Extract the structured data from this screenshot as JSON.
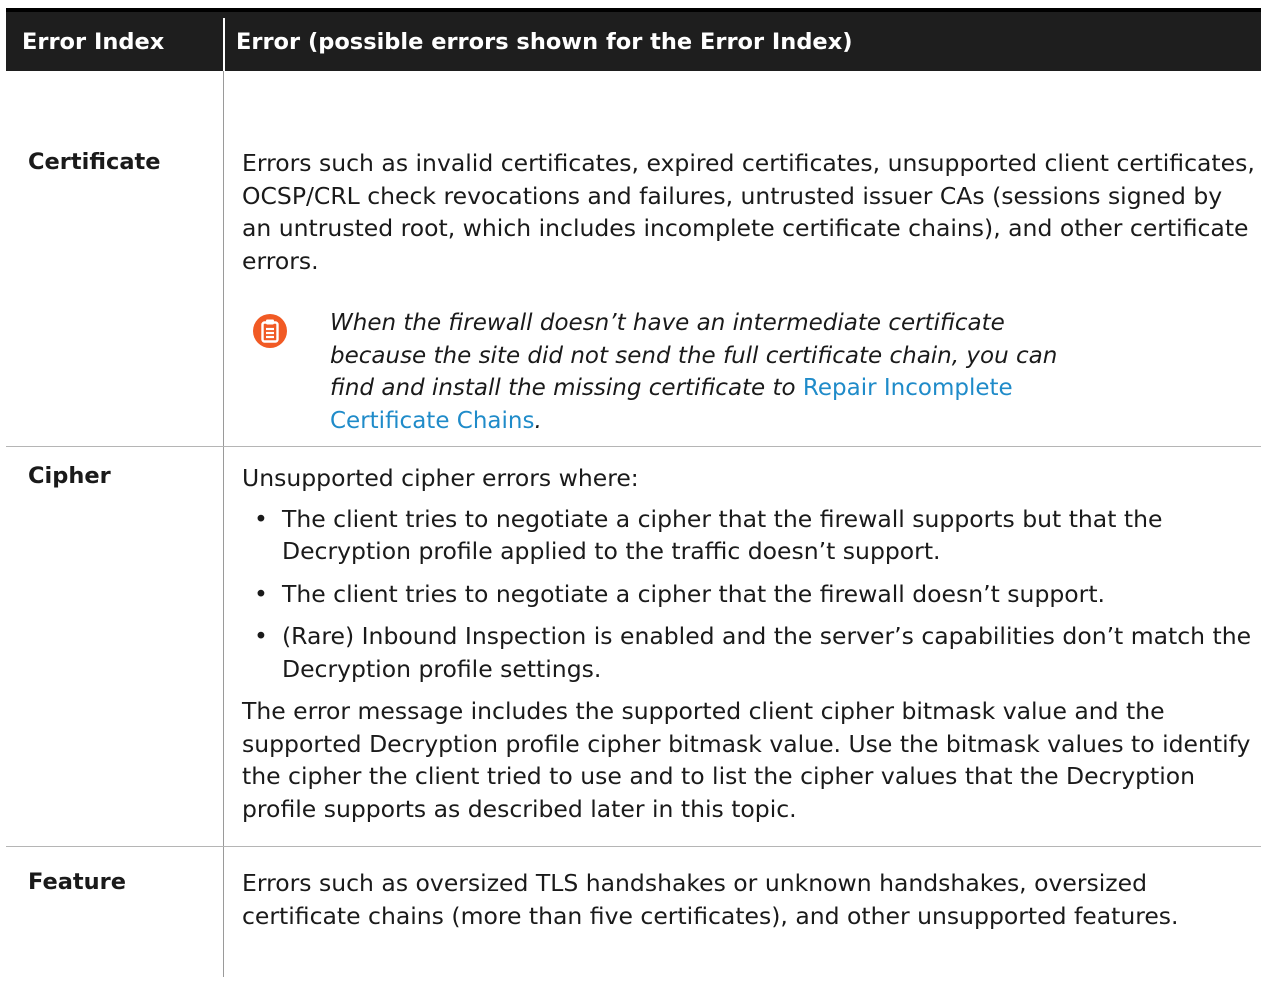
{
  "header": {
    "col1": "Error Index",
    "col2": "Error (possible errors shown for the Error Index)"
  },
  "rows": {
    "certificate": {
      "label": "Certificate",
      "text": "Errors such as invalid certificates, expired certificates, unsupported client certificates, OCSP/CRL check revocations and failures, untrusted issuer CAs (sessions signed by an untrusted root, which includes incomplete certificate chains), and other certificate errors.",
      "note": {
        "icon": "note-clipboard-icon",
        "text": "When the firewall doesn’t have an intermediate certificate because the site did not send the full certificate chain, you can find and install the missing certificate to ",
        "link": "Repair Incomplete Certificate Chains",
        "after": "."
      }
    },
    "cipher": {
      "label": "Cipher",
      "intro": "Unsupported cipher errors where:",
      "bullets": [
        "The client tries to negotiate a cipher that the firewall supports but that the Decryption profile applied to the traffic doesn’t support.",
        "The client tries to negotiate a cipher that the firewall doesn’t support.",
        "(Rare) Inbound Inspection is enabled and the server’s capabilities don’t match the Decryption profile settings."
      ],
      "closing": "The error message includes the supported client cipher bitmask value and the supported Decryption profile cipher bitmask value. Use the bitmask values to identify the cipher the client tried to use and to list the cipher values that the Decryption profile supports as described later in this topic."
    },
    "feature": {
      "label": "Feature",
      "text": "Errors such as oversized TLS handshakes or unknown handshakes, oversized certificate chains (more than five certificates), and other unsupported features."
    }
  },
  "colors": {
    "header_bg": "#1e1e1e",
    "link": "#1f8bc9",
    "note_icon": "#f15a24"
  }
}
